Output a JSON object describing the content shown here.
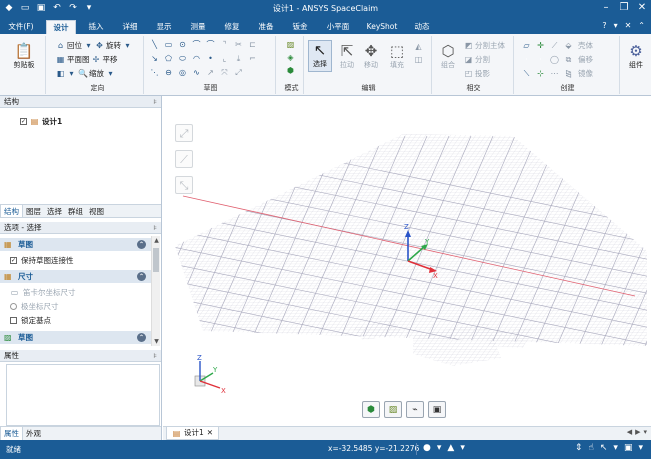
{
  "titlebar": {
    "title": "设计1 - ANSYS SpaceClaim",
    "quick_icons": [
      "app-icon",
      "open-icon",
      "save-icon",
      "undo-icon",
      "redo-icon",
      "customize-icon"
    ],
    "controls": [
      "minimize",
      "restore",
      "close"
    ]
  },
  "menubar": {
    "tabs": [
      {
        "label": "文件(F)",
        "active": false
      },
      {
        "label": "设计",
        "active": true
      },
      {
        "label": "插入",
        "active": false
      },
      {
        "label": "详细",
        "active": false
      },
      {
        "label": "显示",
        "active": false
      },
      {
        "label": "测量",
        "active": false
      },
      {
        "label": "修复",
        "active": false
      },
      {
        "label": "准备",
        "active": false
      },
      {
        "label": "钣金",
        "active": false
      },
      {
        "label": "小平面",
        "active": false
      },
      {
        "label": "KeyShot",
        "active": false
      },
      {
        "label": "动态",
        "active": false
      }
    ],
    "right_icons": [
      "help-icon",
      "settings-icon",
      "close-ribbon-icon",
      "expand-icon"
    ]
  },
  "ribbon": {
    "clipboard": {
      "label": "剪贴板"
    },
    "orient": {
      "label": "定向",
      "home": "回位",
      "rotate": "旋转",
      "plan_view": "平面图",
      "pan": "平移",
      "zoom": "缩放"
    },
    "sketch": {
      "label": "草图"
    },
    "mode": {
      "label": "模式"
    },
    "edit": {
      "label": "编辑",
      "select": "选择",
      "pull": "拉动",
      "move": "移动",
      "fill": "填充"
    },
    "intersect": {
      "label": "相交",
      "combine": "组合",
      "split_body": "分割主体",
      "split": "分割",
      "project": "投影"
    },
    "create": {
      "label": "创建",
      "shell": "壳体",
      "offset": "偏移",
      "mirror": "镜像"
    },
    "component": {
      "label": "组件"
    }
  },
  "structure_panel": {
    "title": "结构",
    "tree_item": "设计1",
    "tabs": [
      {
        "label": "结构",
        "active": true
      },
      {
        "label": "图层",
        "active": false
      },
      {
        "label": "选择",
        "active": false
      },
      {
        "label": "群组",
        "active": false
      },
      {
        "label": "视图",
        "active": false
      }
    ]
  },
  "options_panel": {
    "title": "选项 - 选择",
    "section1": "草图",
    "keep_sketch_connectivity": "保持草图连接性",
    "section2": "尺寸",
    "cartesian_dimensions": "笛卡尔坐标尺寸",
    "polar_dimensions": "极坐标尺寸",
    "lock_datum": "锁定基点",
    "section3": "草图"
  },
  "properties_panel": {
    "title": "属性",
    "tabs": [
      {
        "label": "属性",
        "active": true
      },
      {
        "label": "外观",
        "active": false
      }
    ]
  },
  "viewport": {
    "triad_big": {
      "z": "Z",
      "y": "Y",
      "x": "X"
    },
    "triad_small": {
      "z": "Z",
      "y": "Y",
      "x": "X"
    },
    "colors": {
      "x_axis": "#e0303a",
      "y_axis": "#2ea84a",
      "z_axis": "#2a54c8",
      "grid": "#b8b8c8"
    }
  },
  "doc_tabs": {
    "active_doc": "设计1"
  },
  "statusbar": {
    "status": "就绪",
    "coords": "x=-32.5485  y=-21.2276"
  }
}
